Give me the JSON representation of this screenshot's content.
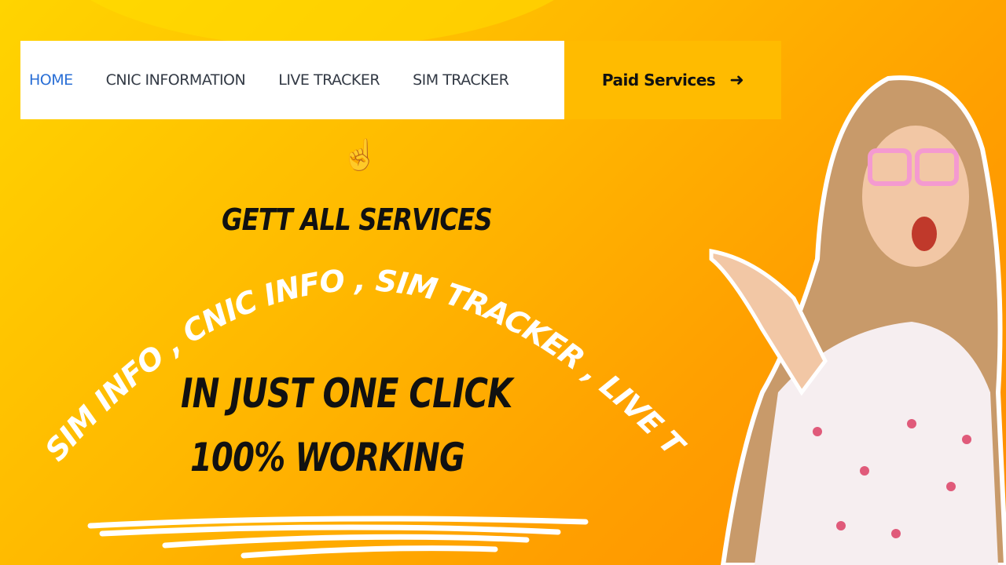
{
  "nav": {
    "items": [
      {
        "label": "HOME",
        "active": true
      },
      {
        "label": "CNIC INFORMATION"
      },
      {
        "label": "LIVE TRACKER"
      },
      {
        "label": "SIM TRACKER"
      }
    ],
    "paid_label": "Paid Services",
    "paid_icon": "arrow-right-icon"
  },
  "headline": "GETT ALL SERVICES",
  "arc_text": "SIM INFO , CNIC INFO , SIM TRACKER , LIVE TRACKING",
  "line2": "IN JUST ONE CLICK",
  "line3": "100%  WORKING",
  "hand_icon": "pointing-hand-icon",
  "colors": {
    "active": "#2a6fd6",
    "paid_bg": "#ffbb00"
  }
}
